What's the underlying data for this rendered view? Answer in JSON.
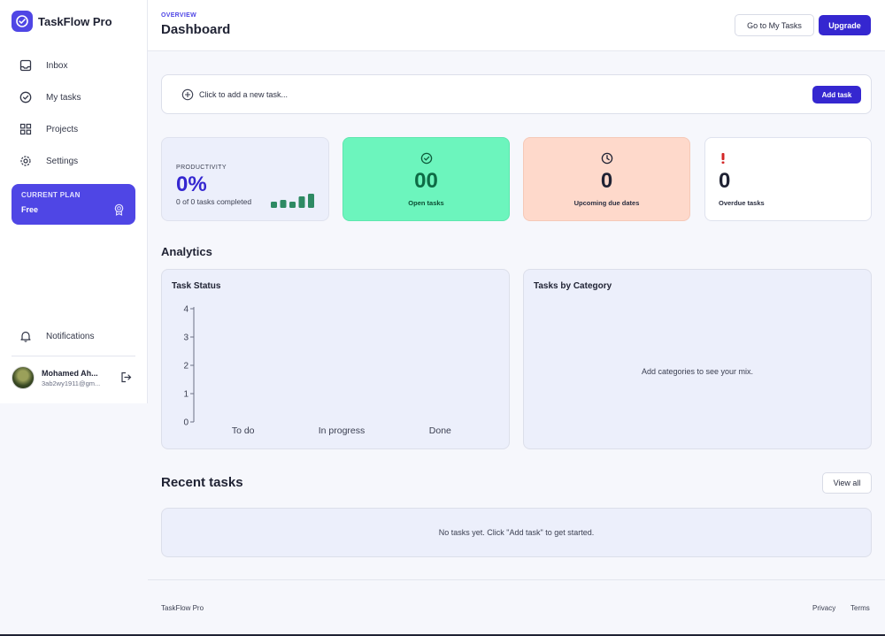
{
  "brand": {
    "name": "TaskFlow Pro"
  },
  "sidebar": {
    "items": [
      {
        "label": "Inbox",
        "icon": "inbox-icon"
      },
      {
        "label": "My tasks",
        "icon": "check-circle-icon"
      },
      {
        "label": "Projects",
        "icon": "grid-icon"
      },
      {
        "label": "Settings",
        "icon": "gear-icon"
      }
    ],
    "plan": {
      "eyebrow": "CURRENT PLAN",
      "name": "Free",
      "icon": "award-icon"
    },
    "notifications_label": "Notifications",
    "user": {
      "name": "Mohamed Ah...",
      "email": "3ab2wy1911@gm..."
    }
  },
  "header": {
    "eyebrow": "OVERVIEW",
    "title": "Dashboard",
    "go_tasks_label": "Go to My Tasks",
    "upgrade_label": "Upgrade"
  },
  "add_task": {
    "placeholder": "Click to add a new task...",
    "button_label": "Add task"
  },
  "stats": {
    "productivity": {
      "eyebrow": "PRODUCTIVITY",
      "value": "0%",
      "sub": "0 of 0 tasks completed"
    },
    "open": {
      "value": "00",
      "label": "Open tasks"
    },
    "due": {
      "value": "0",
      "label": "Upcoming due dates"
    },
    "overdue": {
      "value": "0",
      "label": "Overdue tasks"
    }
  },
  "analytics": {
    "title": "Analytics",
    "status_panel_title": "Task Status",
    "category_panel_title": "Tasks by Category",
    "category_empty": "Add categories to see your mix."
  },
  "chart_data": {
    "type": "bar",
    "title": "Task Status",
    "categories": [
      "To do",
      "In progress",
      "Done"
    ],
    "values": [
      0,
      0,
      0
    ],
    "yticks": [
      "0",
      "1",
      "2",
      "3",
      "4"
    ],
    "ylim": [
      0,
      4
    ],
    "xlabel": "",
    "ylabel": ""
  },
  "recent": {
    "title": "Recent tasks",
    "view_all_label": "View all",
    "empty": "No tasks yet. Click \"Add task\" to get started."
  },
  "footer": {
    "brand": "TaskFlow Pro",
    "privacy": "Privacy",
    "terms": "Terms"
  },
  "colors": {
    "accent": "#4f46e5",
    "primary_button": "#3527d0",
    "open_card": "#6cf5bd",
    "due_card": "#fed9cb",
    "overdue_mark": "#d32626",
    "spark_bar": "#2e8a63"
  }
}
